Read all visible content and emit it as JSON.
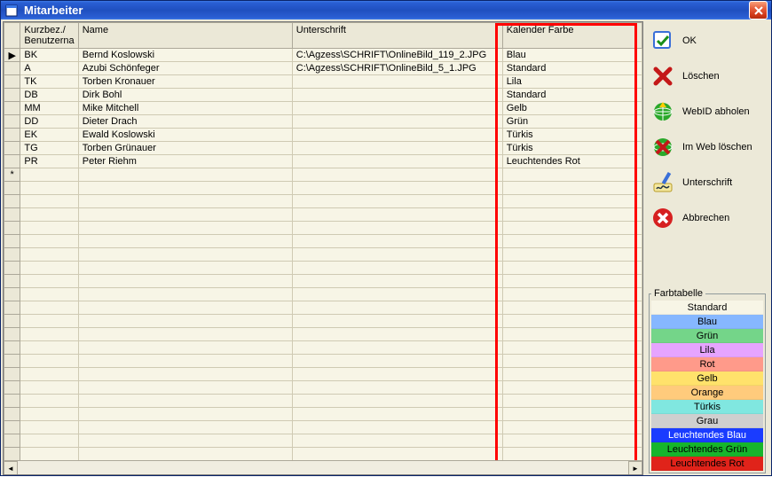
{
  "window": {
    "title": "Mitarbeiter",
    "close_icon": "close-icon"
  },
  "grid": {
    "headers": {
      "kurz": "Kurzbez./\nBenutzerna",
      "name": "Name",
      "unterschrift": "Unterschrift",
      "farbe": "Kalender Farbe"
    },
    "rows": [
      {
        "marker": "▶",
        "kurz": "BK",
        "name": "Bernd Koslowski",
        "unterschrift": "C:\\Agzess\\SCHRIFT\\OnlineBild_119_2.JPG",
        "farbe": "Blau"
      },
      {
        "marker": "",
        "kurz": "A",
        "name": "Azubi Schönfeger",
        "unterschrift": "C:\\Agzess\\SCHRIFT\\OnlineBild_5_1.JPG",
        "farbe": "Standard"
      },
      {
        "marker": "",
        "kurz": "TK",
        "name": "Torben Kronauer",
        "unterschrift": "",
        "farbe": "Lila"
      },
      {
        "marker": "",
        "kurz": "DB",
        "name": "Dirk Bohl",
        "unterschrift": "",
        "farbe": "Standard"
      },
      {
        "marker": "",
        "kurz": "MM",
        "name": "Mike Mitchell",
        "unterschrift": "",
        "farbe": "Gelb"
      },
      {
        "marker": "",
        "kurz": "DD",
        "name": "Dieter Drach",
        "unterschrift": "",
        "farbe": "Grün"
      },
      {
        "marker": "",
        "kurz": "EK",
        "name": "Ewald Koslowski",
        "unterschrift": "",
        "farbe": "Türkis"
      },
      {
        "marker": "",
        "kurz": "TG",
        "name": "Torben Grünauer",
        "unterschrift": "",
        "farbe": "Türkis"
      },
      {
        "marker": "",
        "kurz": "PR",
        "name": "Peter Riehm",
        "unterschrift": "",
        "farbe": "Leuchtendes Rot"
      },
      {
        "marker": "*",
        "kurz": "",
        "name": "",
        "unterschrift": "",
        "farbe": ""
      }
    ],
    "empty_rows": 22
  },
  "actions": [
    {
      "id": "ok",
      "label": "OK"
    },
    {
      "id": "loeschen",
      "label": "Löschen"
    },
    {
      "id": "webid",
      "label": "WebID abholen"
    },
    {
      "id": "imweb",
      "label": "Im Web löschen"
    },
    {
      "id": "unterschrift",
      "label": "Unterschrift"
    },
    {
      "id": "abbrechen",
      "label": "Abbrechen"
    }
  ],
  "farbtabelle": {
    "legend": "Farbtabelle",
    "items": [
      {
        "label": "Standard",
        "bg": "#f7f5e6",
        "fg": "#000"
      },
      {
        "label": "Blau",
        "bg": "#86b7ff",
        "fg": "#000"
      },
      {
        "label": "Grün",
        "bg": "#74d589",
        "fg": "#000"
      },
      {
        "label": "Lila",
        "bg": "#e6a4ff",
        "fg": "#000"
      },
      {
        "label": "Rot",
        "bg": "#ff9a8a",
        "fg": "#000"
      },
      {
        "label": "Gelb",
        "bg": "#ffe26b",
        "fg": "#000"
      },
      {
        "label": "Orange",
        "bg": "#ffcb7c",
        "fg": "#000"
      },
      {
        "label": "Türkis",
        "bg": "#80e7e0",
        "fg": "#000"
      },
      {
        "label": "Grau",
        "bg": "#cfcfcf",
        "fg": "#000"
      },
      {
        "label": "Leuchtendes Blau",
        "bg": "#1a3cff",
        "fg": "#fff"
      },
      {
        "label": "Leuchtendes Grün",
        "bg": "#16b52c",
        "fg": "#000"
      },
      {
        "label": "Leuchtendes Rot",
        "bg": "#e0231a",
        "fg": "#000"
      }
    ]
  }
}
